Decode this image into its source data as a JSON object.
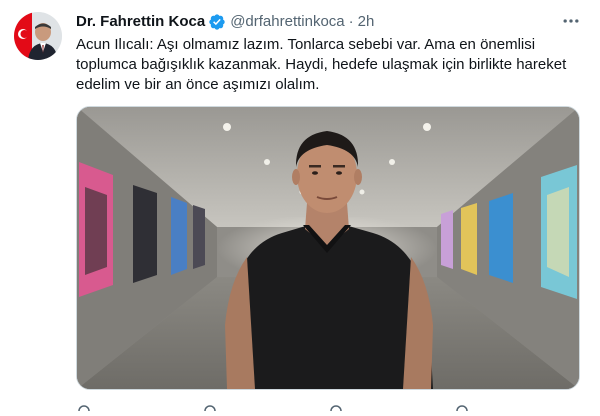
{
  "tweet": {
    "author": {
      "display_name": "Dr. Fahrettin Koca",
      "handle": "@drfahrettinkoca",
      "separator": "·",
      "time": "2h"
    },
    "text": "Acun Ilıcalı: Aşı olmamız lazım. Tonlarca sebebi var. Ama en önemlisi\ntoplumca bağışıklık kazanmak. Haydi, hedefe ulaşmak için birlikte hareket\nedelim ve bir an önce aşımızı olalım.",
    "media": {
      "type": "video-still",
      "icon": "video-frame"
    }
  },
  "colors": {
    "verified": "#1d9bf0",
    "secondary_text": "#536471",
    "primary_text": "#0f1419",
    "border": "#cfd9de"
  },
  "icons": {
    "more": "more-horizontal-icon",
    "verified": "verified-badge-icon"
  }
}
